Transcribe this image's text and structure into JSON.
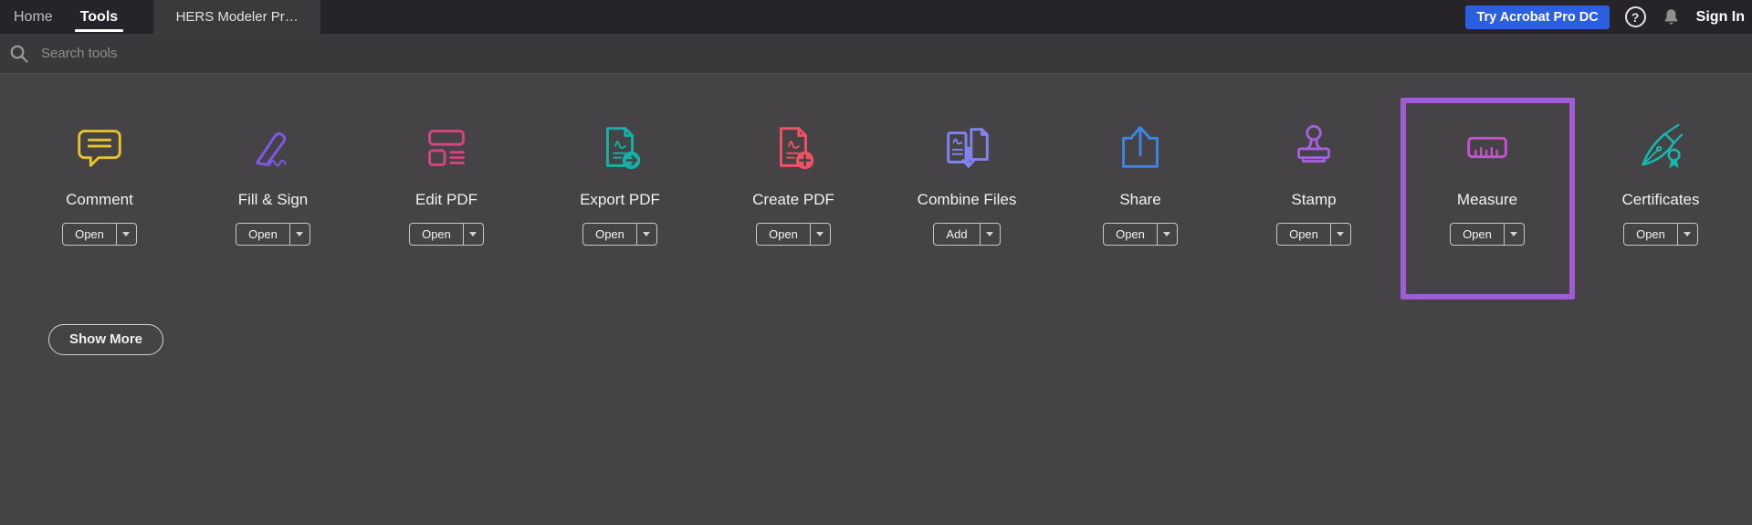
{
  "topbar": {
    "tabs": [
      {
        "label": "Home",
        "active": false
      },
      {
        "label": "Tools",
        "active": true
      }
    ],
    "document_tab": {
      "label": "HERS Modeler Pr…"
    },
    "try_button_label": "Try Acrobat Pro DC",
    "sign_in_label": "Sign In"
  },
  "search": {
    "placeholder": "Search tools"
  },
  "tools": [
    {
      "label": "Comment",
      "action": "Open",
      "icon": "comment-bubble-icon",
      "color": "#e6c32b",
      "highlighted": false
    },
    {
      "label": "Fill & Sign",
      "action": "Open",
      "icon": "signature-pen-icon",
      "color": "#7f58e8",
      "highlighted": false
    },
    {
      "label": "Edit PDF",
      "action": "Open",
      "icon": "edit-blocks-icon",
      "color": "#d64583",
      "highlighted": false
    },
    {
      "label": "Export PDF",
      "action": "Open",
      "icon": "export-pdf-icon",
      "color": "#14b2a6",
      "highlighted": false
    },
    {
      "label": "Create PDF",
      "action": "Open",
      "icon": "create-pdf-icon",
      "color": "#f05263",
      "highlighted": false
    },
    {
      "label": "Combine Files",
      "action": "Add",
      "icon": "combine-files-icon",
      "color": "#8184ee",
      "highlighted": false
    },
    {
      "label": "Share",
      "action": "Open",
      "icon": "share-arrow-icon",
      "color": "#3d87e4",
      "highlighted": false
    },
    {
      "label": "Stamp",
      "action": "Open",
      "icon": "stamp-icon",
      "color": "#a560dc",
      "highlighted": false
    },
    {
      "label": "Measure",
      "action": "Open",
      "icon": "ruler-icon",
      "color": "#c84fd6",
      "highlighted": true
    },
    {
      "label": "Certificates",
      "action": "Open",
      "icon": "certificate-pen-icon",
      "color": "#16b8ad",
      "highlighted": false
    }
  ],
  "show_more_label": "Show More",
  "colors": {
    "accent_blue": "#2b5ee0",
    "highlight_purple": "#a05cd5",
    "background": "#454346",
    "topbar_background": "#262428"
  }
}
